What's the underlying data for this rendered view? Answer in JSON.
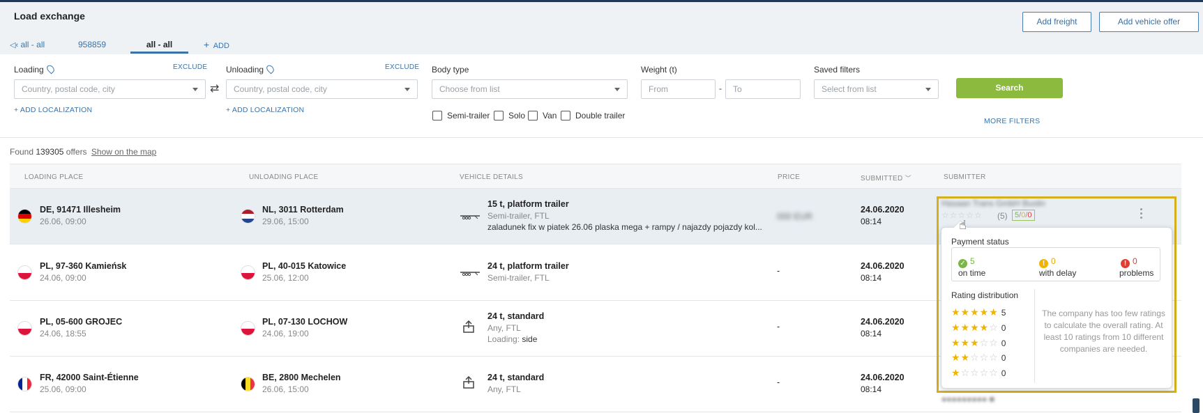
{
  "header": {
    "title": "Load exchange",
    "tabs": [
      {
        "label": "all - all",
        "icon": "speaker-icon"
      },
      {
        "label": "958859"
      },
      {
        "label": "all - all",
        "active": true
      }
    ],
    "add_tab_label": "ADD",
    "add_freight": "Add freight",
    "add_vehicle_offer": "Add vehicle offer"
  },
  "filters": {
    "loading_label": "Loading",
    "unloading_label": "Unloading",
    "exclude": "EXCLUDE",
    "location_placeholder": "Country, postal code, city",
    "add_localization": "ADD LOCALIZATION",
    "body_type_label": "Body type",
    "body_type_placeholder": "Choose from list",
    "body_types": [
      "Semi-trailer",
      "Solo",
      "Van",
      "Double trailer"
    ],
    "weight_label": "Weight (t)",
    "weight_from": "From",
    "weight_sep": "-",
    "weight_to": "To",
    "saved_filters_label": "Saved filters",
    "saved_filters_placeholder": "Select from list",
    "search": "Search",
    "more_filters": "MORE FILTERS"
  },
  "results": {
    "found_prefix": "Found",
    "count": "139305",
    "found_suffix": "offers",
    "show_on_map": "Show on the map"
  },
  "table": {
    "columns": {
      "loading": "LOADING PLACE",
      "unloading": "UNLOADING PLACE",
      "vehicle": "VEHICLE DETAILS",
      "price": "PRICE",
      "submitted": "SUBMITTED",
      "submitter": "SUBMITTER"
    },
    "rows": [
      {
        "load_place": "DE, 91471 Illesheim",
        "load_date": "26.06, 09:00",
        "load_flag": "de",
        "unload_place": "NL, 3011 Rotterdam",
        "unload_date": "29.06, 15:00",
        "unload_flag": "nl",
        "vehicle": "15 t, platform trailer",
        "vehicle_sub": "Semi-trailer, FTL",
        "vehicle_desc": "zaladunek fix w piatek 26.06 plaska mega + rampy / najazdy pojazdy kol...",
        "vehicle_icon": "platform-trailer-icon",
        "price": "000 EUR",
        "date": "24.06.2020",
        "time": "08:14"
      },
      {
        "load_place": "PL, 97-360 Kamieńsk",
        "load_date": "24.06, 09:00",
        "load_flag": "pl",
        "unload_place": "PL, 40-015 Katowice",
        "unload_date": "25.06, 12:00",
        "unload_flag": "pl",
        "vehicle": "24 t, platform trailer",
        "vehicle_sub": "Semi-trailer, FTL",
        "vehicle_icon": "platform-trailer-icon",
        "price": "-",
        "date": "24.06.2020",
        "time": "08:14"
      },
      {
        "load_place": "PL, 05-600 GROJEC",
        "load_date": "24.06, 18:55",
        "load_flag": "pl",
        "unload_place": "PL, 07-130 LOCHOW",
        "unload_date": "24.06, 19:00",
        "unload_flag": "pl",
        "vehicle": "24 t, standard",
        "vehicle_sub": "Any, FTL",
        "loading_label": "Loading:",
        "loading_value": "side",
        "vehicle_icon": "standard-box-icon",
        "price": "-",
        "date": "24.06.2020",
        "time": "08:14"
      },
      {
        "load_place": "FR, 42000 Saint-Étienne",
        "load_date": "25.06, 09:00",
        "load_flag": "fr",
        "unload_place": "BE, 2800 Mechelen",
        "unload_date": "26.06, 15:00",
        "unload_flag": "be",
        "vehicle": "24 t, standard",
        "vehicle_sub": "Any, FTL",
        "vehicle_icon": "standard-box-icon",
        "price": "-",
        "date": "24.06.2020",
        "time": "08:14"
      }
    ]
  },
  "submitter": {
    "name_blurred": "Hasaan Trans GmbH Buslin",
    "rating_count": "(5)",
    "payment_summary": [
      "5",
      "0",
      "0"
    ],
    "popup": {
      "payment_title": "Payment status",
      "on_time_count": "5",
      "on_time_label": "on time",
      "delay_count": "0",
      "delay_label": "with delay",
      "problems_count": "0",
      "problems_label": "problems",
      "rating_title": "Rating distribution",
      "distribution": [
        {
          "stars": 5,
          "count": "5"
        },
        {
          "stars": 4,
          "count": "0"
        },
        {
          "stars": 3,
          "count": "0"
        },
        {
          "stars": 2,
          "count": "0"
        },
        {
          "stars": 1,
          "count": "0"
        }
      ],
      "note": "The company has too few ratings to calculate the overall rating. At least 10 ratings from 10 different companies are needed."
    }
  },
  "colors": {
    "accent": "#3a73a8",
    "search_green": "#8bba3f",
    "highlight": "#d4b01e",
    "star": "#f0b400",
    "ok": "#7ab648",
    "warn": "#f0b400",
    "error": "#e03c31"
  }
}
